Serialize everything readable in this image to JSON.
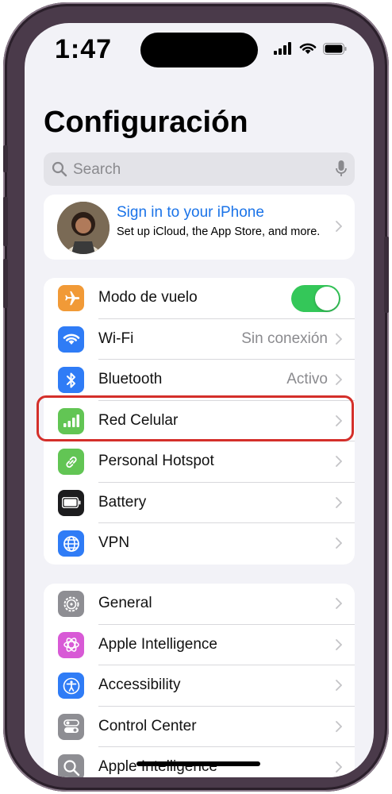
{
  "status_bar": {
    "time": "1:47"
  },
  "page": {
    "title": "Configuración"
  },
  "search": {
    "placeholder": "Search"
  },
  "profile": {
    "name": "Sign in to your iPhone",
    "subtitle": "Set up iCloud, the App Store, and more."
  },
  "group1": [
    {
      "label": "Modo de vuelo",
      "icon": "airplane-icon",
      "color": "#f19a37",
      "toggle": true
    },
    {
      "label": "Wi-Fi",
      "icon": "wifi-icon",
      "color": "#2f7cf6",
      "value": "Sin conexión"
    },
    {
      "label": "Bluetooth",
      "icon": "bluetooth-icon",
      "color": "#2f7cf6",
      "value": "Activo"
    },
    {
      "label": "Red Celular",
      "icon": "cellular-icon",
      "color": "#62c554"
    },
    {
      "label": "Personal Hotspot",
      "icon": "hotspot-icon",
      "color": "#62c554"
    },
    {
      "label": "Battery",
      "icon": "battery-icon",
      "color": "#1c1c1e"
    },
    {
      "label": "VPN",
      "icon": "vpn-globe-icon",
      "color": "#2f7cf6"
    }
  ],
  "group2": [
    {
      "label": "General",
      "icon": "gear-icon",
      "color": "#8e8e93"
    },
    {
      "label": "Apple Intelligence",
      "icon": "apple-intelligence-icon",
      "color": "#d85ad6"
    },
    {
      "label": "Accessibility",
      "icon": "accessibility-icon",
      "color": "#2f7cf6"
    },
    {
      "label": "Control Center",
      "icon": "control-center-icon",
      "color": "#8e8e93"
    },
    {
      "label": "Apple Intelligence",
      "icon": "search-icon",
      "color": "#8e8e93"
    }
  ],
  "colors": {
    "accent": "#1a73e8",
    "toggle_on": "#34c759",
    "highlight": "#d42f2a"
  }
}
